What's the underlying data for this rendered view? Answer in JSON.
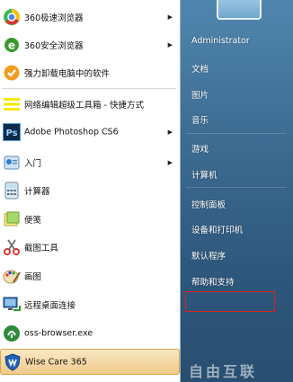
{
  "programs": [
    {
      "label": "360极速浏览器",
      "icon": "chrome-like-icon",
      "has_submenu": true
    },
    {
      "label": "360安全浏览器",
      "icon": "ie-like-icon",
      "has_submenu": true
    },
    {
      "label": "强力卸载电脑中的软件",
      "icon": "uninstall-icon",
      "has_submenu": false
    },
    {
      "label": "网络编辑超级工具箱 - 快捷方式",
      "icon": "toolbox-icon",
      "has_submenu": false
    },
    {
      "label": "Adobe Photoshop CS6",
      "icon": "photoshop-icon",
      "has_submenu": true
    },
    {
      "label": "入门",
      "icon": "getting-started-icon",
      "has_submenu": true
    },
    {
      "label": "计算器",
      "icon": "calculator-icon",
      "has_submenu": false
    },
    {
      "label": "便笺",
      "icon": "sticky-notes-icon",
      "has_submenu": false
    },
    {
      "label": "截图工具",
      "icon": "snipping-tool-icon",
      "has_submenu": false
    },
    {
      "label": "画图",
      "icon": "paint-icon",
      "has_submenu": false
    },
    {
      "label": "远程桌面连接",
      "icon": "remote-desktop-icon",
      "has_submenu": false
    },
    {
      "label": "oss-browser.exe",
      "icon": "oss-browser-icon",
      "has_submenu": false
    },
    {
      "label": "Wise Care 365",
      "icon": "wise-care-icon",
      "has_submenu": false
    }
  ],
  "right_items": [
    "Administrator",
    "文档",
    "图片",
    "音乐",
    "游戏",
    "计算机",
    "控制面板",
    "设备和打印机",
    "默认程序",
    "帮助和支持"
  ],
  "submenu_arrow": "▶",
  "watermark": "自由互联"
}
